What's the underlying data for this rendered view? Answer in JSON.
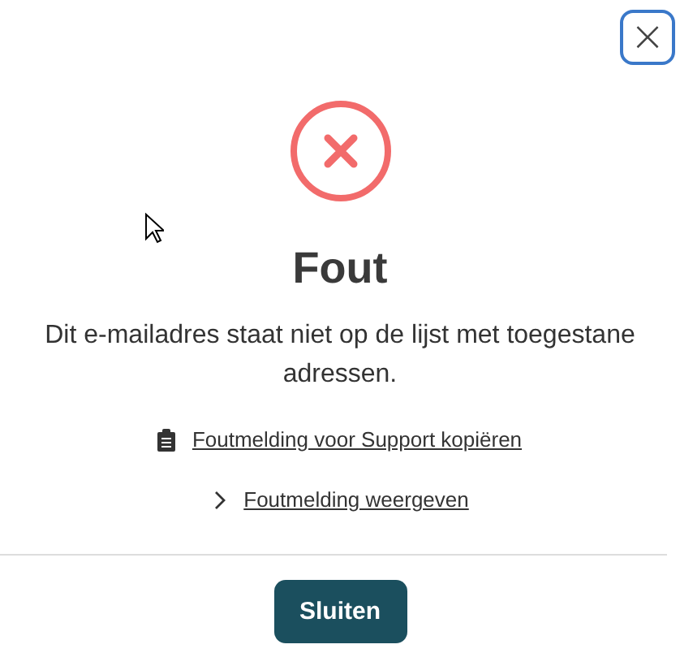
{
  "dialog": {
    "close_button": "×",
    "title": "Fout",
    "message": "Dit e-mailadres staat niet op de lijst met toegestane adressen.",
    "links": [
      {
        "kind": "copy",
        "label": "Foutmelding voor Support kopiëren"
      },
      {
        "kind": "expand",
        "label": "Foutmelding weergeven",
        "expanded": false
      }
    ],
    "button": "Sluiten"
  }
}
